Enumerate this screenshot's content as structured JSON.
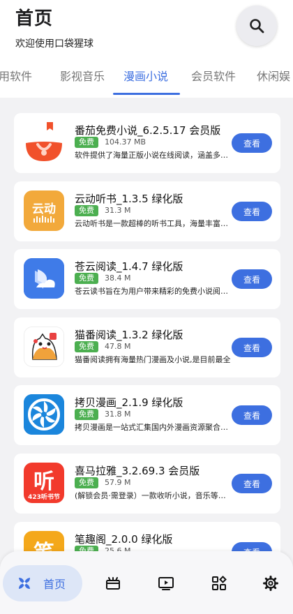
{
  "header": {
    "title": "首页",
    "subtitle": "欢迎使用口袋猩球",
    "search_icon": "search-icon"
  },
  "tabs": [
    {
      "label": "常用软件",
      "active": false
    },
    {
      "label": "影视音乐",
      "active": false
    },
    {
      "label": "漫画小说",
      "active": true
    },
    {
      "label": "会员软件",
      "active": false
    },
    {
      "label": "休闲娱",
      "active": false
    }
  ],
  "apps": [
    {
      "name": "番茄免费小说_6.2.5.17 会员版",
      "badge": "免费",
      "size": "104.37 MB",
      "desc": "软件提供了海量正版小说在线阅读，涵盖多种题材",
      "button": "查看",
      "icon": "tomato-novel-icon"
    },
    {
      "name": "云动听书_1.3.5 绿化版",
      "badge": "免费",
      "size": "31.3 M",
      "desc": "云动听书是一款超棒的听书工具，海量丰富资源",
      "button": "查看",
      "icon": "yundong-icon",
      "icon_text": "云动"
    },
    {
      "name": "苍云阅读_1.4.7 绿化版",
      "badge": "免费",
      "size": "38.4 M",
      "desc": "苍云读书旨在为用户带来精彩的免费小说阅读体验",
      "button": "查看",
      "icon": "cangyun-icon"
    },
    {
      "name": "猫番阅读_1.3.2 绿化版",
      "badge": "免费",
      "size": "47.8 M",
      "desc": "猫番阅读拥有海量热门漫画及小说,是目前最全",
      "button": "查看",
      "icon": "maofan-icon"
    },
    {
      "name": "拷贝漫画_2.1.9 绿化版",
      "badge": "免费",
      "size": "31.8 M",
      "desc": "拷贝漫画是一站式汇集国内外漫画资源聚合平台",
      "button": "查看",
      "icon": "copy-manga-icon"
    },
    {
      "name": "喜马拉雅_3.2.69.3 会员版",
      "badge": "免费",
      "size": "57.9 M",
      "desc": "(解锁会员·需登录）一款收听小说，音乐等节目",
      "button": "查看",
      "icon": "ximalaya-icon",
      "icon_text": "听",
      "icon_sub": "423听书节"
    },
    {
      "name": "笔趣阁_2.0.0 绿化版",
      "badge": "免费",
      "size": "25.6 M",
      "desc": "",
      "button": "查看",
      "icon": "biquge-icon",
      "icon_text": "笔"
    }
  ],
  "bottom_nav": {
    "home_label": "首页"
  },
  "colors": {
    "accent": "#3d6fe0",
    "badge": "#4caf50",
    "background": "#f2f2f4"
  }
}
